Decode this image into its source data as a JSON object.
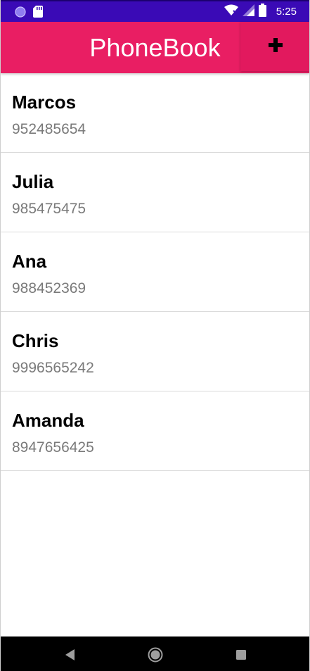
{
  "status_bar": {
    "time": "5:25",
    "icons": [
      "notification-dot-icon",
      "sd-card-icon",
      "wifi-icon",
      "signal-icon",
      "battery-icon"
    ]
  },
  "app_bar": {
    "title": "PhoneBook",
    "add_button_label": "+",
    "color": "#e91e63"
  },
  "contacts": [
    {
      "name": "Marcos",
      "phone": "952485654"
    },
    {
      "name": "Julia",
      "phone": "985475475"
    },
    {
      "name": "Ana",
      "phone": "988452369"
    },
    {
      "name": "Chris",
      "phone": "9996565242"
    },
    {
      "name": "Amanda",
      "phone": "8947656425"
    }
  ],
  "nav_bar": {
    "buttons": [
      "back-icon",
      "home-icon",
      "recents-icon"
    ]
  }
}
